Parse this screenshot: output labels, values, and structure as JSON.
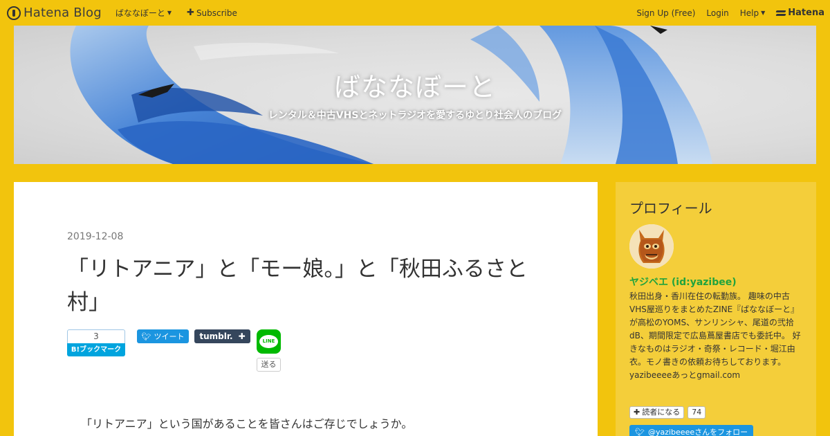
{
  "topbar": {
    "brand": "Hatena Blog",
    "blog_menu": "ばななぼーと",
    "subscribe": "Subscribe",
    "signup": "Sign Up (Free)",
    "login": "Login",
    "help": "Help",
    "hatena": "Hatena"
  },
  "header": {
    "title": "ばななぼーと",
    "description": "レンタル＆中古VHSとネットラジオを愛するゆとり社会人のブログ"
  },
  "article": {
    "date": "2019-12-08",
    "title": "「リトアニア」と「モー娘。」と「秋田ふるさと村」",
    "bookmark_count": "3",
    "bookmark_label": "B!ブックマーク",
    "tweet_label": "ツイート",
    "tumblr_label": "tumblr.",
    "line_label": "LINE",
    "line_send": "送る",
    "first_paragraph": "「リトアニア」という国があることを皆さんはご存じでしょうか。"
  },
  "sidebar": {
    "title": "プロフィール",
    "name": "ヤジベエ (id:yazibee)",
    "description": "秋田出身・香川在住の転勤族。 趣味の中古VHS屋巡りをまとめたZINE『ばななぼーと』が高松のYOMS、サンリンシャ、尾道の弐拾dB、期間限定で広島蔦屋書店でも委託中。 好きなものはラジオ・奇祭・レコード・堀江由衣。モノ書きの依頼お待ちしております。 yazibeeeeあっとgmail.com",
    "reader_button": "読者になる",
    "reader_count": "74",
    "follow_button": "@yazibeeeeさんをフォロー"
  },
  "colors": {
    "background": "#f2c40d",
    "sidebar": "#f4ce3a",
    "profile_name": "#21a33d",
    "twitter": "#1b95e0",
    "tumblr": "#35465c",
    "hatena_bookmark": "#00a4de",
    "line": "#00b900"
  }
}
